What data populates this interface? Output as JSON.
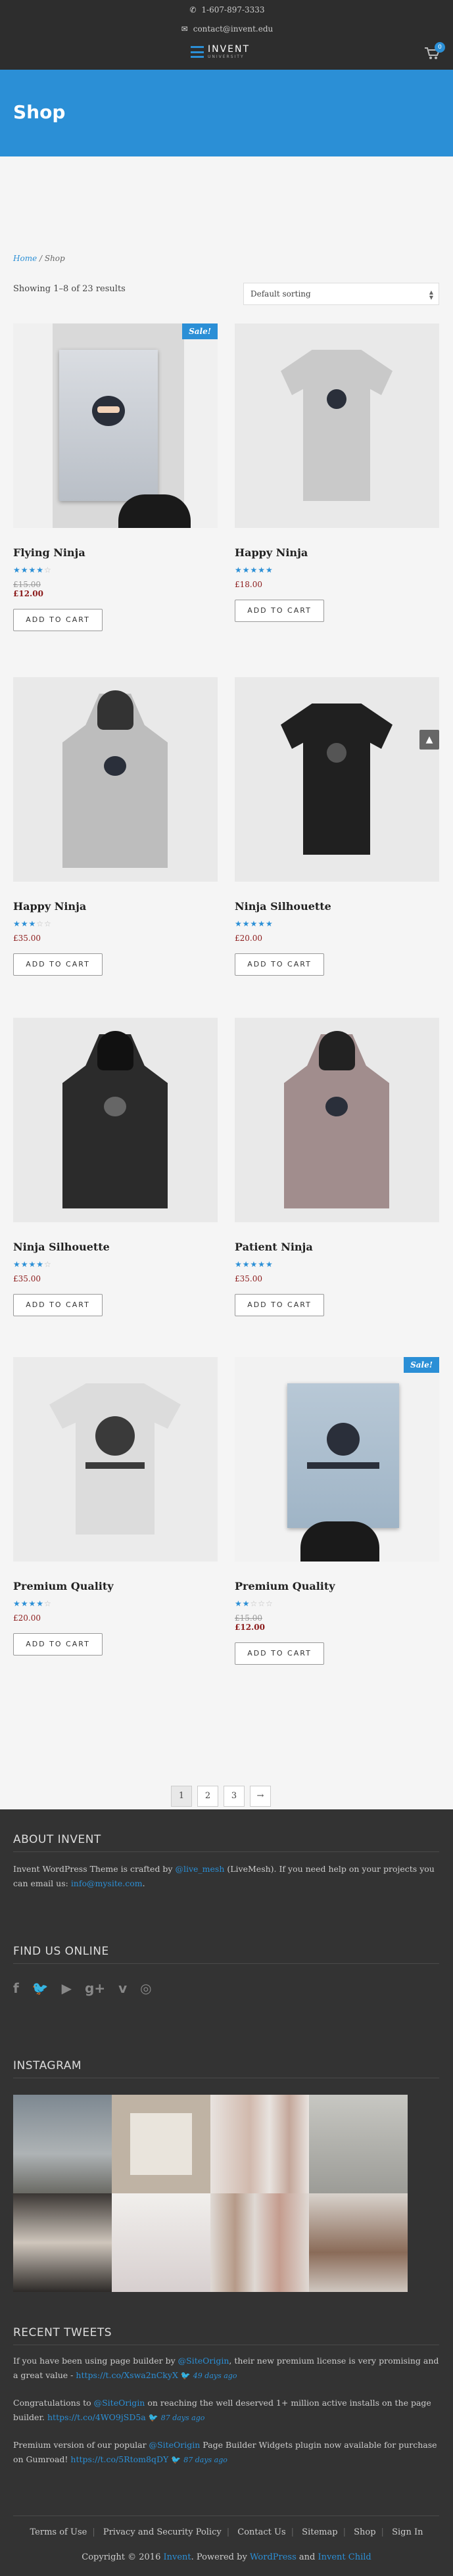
{
  "header": {
    "phone": "1-607-897-3333",
    "email": "contact@invent.edu",
    "logo_title": "INVENT",
    "logo_subtitle": "UNIVERSITY",
    "cart_count": "0"
  },
  "banner": {
    "title": "Shop"
  },
  "breadcrumb": {
    "home": "Home",
    "sep": " / ",
    "current": "Shop"
  },
  "shop": {
    "results": "Showing 1–8 of 23 results",
    "sorting": "Default sorting",
    "add_to_cart": "ADD TO CART",
    "sale_label": "Sale!"
  },
  "products": [
    {
      "name": "Flying Ninja",
      "old_price": "£15.00",
      "price": "£12.00",
      "rating": 4,
      "sale": true
    },
    {
      "name": "Happy Ninja",
      "price": "£18.00",
      "rating": 5,
      "sale": false
    },
    {
      "name": "Happy Ninja",
      "price": "£35.00",
      "rating": 3,
      "sale": false
    },
    {
      "name": "Ninja Silhouette",
      "price": "£20.00",
      "rating": 5,
      "sale": false
    },
    {
      "name": "Ninja Silhouette",
      "price": "£35.00",
      "rating": 4,
      "sale": false
    },
    {
      "name": "Patient Ninja",
      "price": "£35.00",
      "rating": 5,
      "sale": false
    },
    {
      "name": "Premium Quality",
      "price": "£20.00",
      "rating": 4,
      "sale": false
    },
    {
      "name": "Premium Quality",
      "old_price": "£15.00",
      "price": "£12.00",
      "rating": 2,
      "sale": true
    }
  ],
  "pagination": [
    "1",
    "2",
    "3",
    "→"
  ],
  "footer": {
    "about_title": "ABOUT INVENT",
    "about_text_1": "Invent WordPress Theme is crafted by ",
    "about_link_1": "@live_mesh",
    "about_text_2": " (LiveMesh). If you need help on your projects you can email us: ",
    "about_link_2": "info@mysite.com",
    "about_text_3": ".",
    "find_title": "FIND US ONLINE",
    "instagram_title": "INSTAGRAM",
    "tweets_title": "RECENT TWEETS",
    "tweets": [
      {
        "pre": "If you have been using page builder by ",
        "handle": "@SiteOrigin",
        "mid": ", their new premium license is very promising and a great value - ",
        "link": "https://t.co/Xswa2nCkyX",
        "ago": "49 days ago"
      },
      {
        "pre": "Congratulations to ",
        "handle": "@SiteOrigin",
        "mid": " on reaching the well deserved 1+ million active installs on the page builder. ",
        "link": "https://t.co/4WO9jSD5a",
        "ago": "87 days ago"
      },
      {
        "pre": "Premium version of our popular ",
        "handle": "@SiteOrigin",
        "mid": " Page Builder Widgets plugin now available for purchase on Gumroad! ",
        "link": "https://t.co/5Rtom8qDY",
        "ago": "87 days ago"
      }
    ],
    "nav": [
      "Terms of Use",
      "Privacy and Security Policy",
      "Contact Us",
      "Sitemap",
      "Shop",
      "Sign In"
    ],
    "copy_pre": "Copyright © 2016 ",
    "copy_brand": "Invent",
    "copy_mid": ". Powered by ",
    "copy_wp": "WordPress",
    "copy_and": " and ",
    "copy_child": "Invent Child"
  },
  "colors": {
    "accent": "#2b8fd6",
    "footer_bg": "#333333",
    "header_bg": "#2d2d2d",
    "price": "#8b1a1a"
  }
}
